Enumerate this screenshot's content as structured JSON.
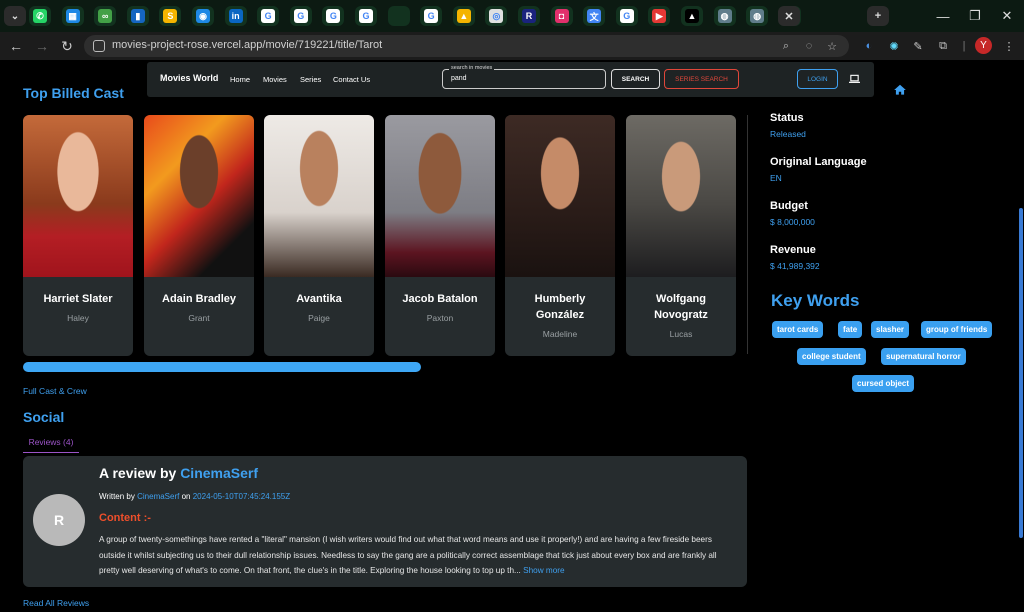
{
  "browser": {
    "tabs": [
      {
        "icon": "whatsapp-icon",
        "color": "#25d366",
        "glyph": "✆"
      },
      {
        "icon": "app-tab-icon",
        "color": "#1e88e5",
        "glyph": "▦"
      },
      {
        "icon": "infinity-tab-icon",
        "color": "#43a047",
        "glyph": "∞"
      },
      {
        "icon": "bookmark-tab-icon",
        "color": "#1565c0",
        "glyph": "▮"
      },
      {
        "icon": "s-tab-icon",
        "color": "#f4b400",
        "glyph": "S"
      },
      {
        "icon": "circle-tab-icon",
        "color": "#1e88e5",
        "glyph": "◉"
      },
      {
        "icon": "linkedin-icon",
        "color": "#0a66c2",
        "glyph": "in"
      },
      {
        "icon": "google-icon",
        "color": "#ffffff",
        "glyph": "G"
      },
      {
        "icon": "google-icon",
        "color": "#ffffff",
        "glyph": "G"
      },
      {
        "icon": "google-icon",
        "color": "#ffffff",
        "glyph": "G"
      },
      {
        "icon": "google-icon",
        "color": "#ffffff",
        "glyph": "G"
      },
      {
        "icon": "blank-tab-icon",
        "color": "#12321f",
        "glyph": ""
      },
      {
        "icon": "google-icon",
        "color": "#ffffff",
        "glyph": "G"
      },
      {
        "icon": "drive-icon",
        "color": "#f4b400",
        "glyph": "▲"
      },
      {
        "icon": "chatgpt-icon",
        "color": "#e0e0e0",
        "glyph": "◎"
      },
      {
        "icon": "r-tab-icon",
        "color": "#1a237e",
        "glyph": "R"
      },
      {
        "icon": "instagram-icon",
        "color": "#e1306c",
        "glyph": "◘"
      },
      {
        "icon": "translate-icon",
        "color": "#4285f4",
        "glyph": "文"
      },
      {
        "icon": "google-icon",
        "color": "#ffffff",
        "glyph": "G"
      },
      {
        "icon": "youtube-icon",
        "color": "#e53935",
        "glyph": "▶"
      },
      {
        "icon": "vercel-icon",
        "color": "#000000",
        "glyph": "▲"
      },
      {
        "icon": "globe-tab-icon",
        "color": "#607d8b",
        "glyph": "◍"
      },
      {
        "icon": "globe-tab-icon",
        "color": "#607d8b",
        "glyph": "◍"
      },
      {
        "icon": "github-icon",
        "color": "#ffffff",
        "glyph": "●"
      }
    ],
    "url": "movies-project-rose.vercel.app/movie/719221/title/Tarot",
    "profile_initial": "Y"
  },
  "navbar": {
    "brand": "Movies World",
    "links": [
      "Home",
      "Movies",
      "Series",
      "Contact Us"
    ],
    "search_legend": "search in movies",
    "search_value": "pand",
    "search_button": "SEARCH",
    "series_search_button": "SERIES SEARCH",
    "login_button": "LOGIN"
  },
  "cast": {
    "title": "Top Billed Cast",
    "members": [
      {
        "name": "Harriet Slater",
        "role": "Haley"
      },
      {
        "name": "Adain Bradley",
        "role": "Grant"
      },
      {
        "name": "Avantika",
        "role": "Paige"
      },
      {
        "name": "Jacob Batalon",
        "role": "Paxton"
      },
      {
        "name": "Humberly González",
        "role": "Madeline"
      },
      {
        "name": "Wolfgang Novogratz",
        "role": "Lucas"
      }
    ],
    "full_cast_link": "Full Cast & Crew"
  },
  "info": {
    "status_label": "Status",
    "status_value": "Released",
    "language_label": "Original Language",
    "language_value": "EN",
    "budget_label": "Budget",
    "budget_value": "$ 8,000,000",
    "revenue_label": "Revenue",
    "revenue_value": "$ 41,989,392"
  },
  "keywords": {
    "title": "Key Words",
    "items": [
      "tarot cards",
      "fate",
      "slasher",
      "group of friends",
      "college student",
      "supernatural horror",
      "cursed object"
    ]
  },
  "social": {
    "title": "Social",
    "tab_label": "Reviews (4)",
    "review": {
      "avatar_initial": "R",
      "title_prefix": "A review by",
      "author": "CinemaSerf",
      "written_by": "Written by",
      "on": "on",
      "date": "2024-05-10T07:45:24.155Z",
      "content_label": "Content :-",
      "body": "A group of twenty-somethings have rented a \"literal\" mansion (I wish writers would find out what that word means and use it properly!) and are having a few fireside beers outside it whilst subjecting us to their dull relationship issues. Needless to say the gang are a politically correct assemblage that tick just about every box and are frankly all pretty well deserving of what's to come. On that front, the clue's in the title. Exploring the house looking to top up th...",
      "show_more": "Show more"
    },
    "read_all": "Read All Reviews"
  }
}
